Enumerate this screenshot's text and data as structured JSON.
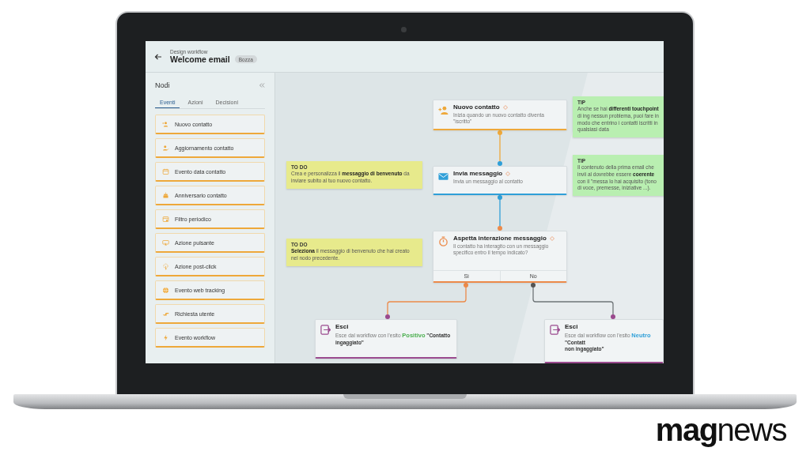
{
  "header": {
    "breadcrumb": "Design workflow",
    "title": "Welcome email",
    "badge": "Bozza"
  },
  "sidebar": {
    "title": "Nodi",
    "tabs": [
      {
        "label": "Eventi",
        "selected": true
      },
      {
        "label": "Azioni",
        "selected": false
      },
      {
        "label": "Decisioni",
        "selected": false
      }
    ],
    "items": [
      {
        "label": "Nuovo contatto"
      },
      {
        "label": "Aggiornamento contatto"
      },
      {
        "label": "Evento data contatto"
      },
      {
        "label": "Anniversario contatto"
      },
      {
        "label": "Filtro periodico"
      },
      {
        "label": "Azione pulsante"
      },
      {
        "label": "Azione post-click"
      },
      {
        "label": "Evento web tracking"
      },
      {
        "label": "Richiesta utente"
      },
      {
        "label": "Evento workflow"
      }
    ]
  },
  "canvas": {
    "nodes": [
      {
        "kind": "event",
        "title": "Nuovo contatto",
        "description": "Inizia quando un nuovo contatto diventa \"iscritto\""
      },
      {
        "kind": "action",
        "title": "Invia messaggio",
        "description": "Invia un messaggio al contatto"
      },
      {
        "kind": "decision",
        "title": "Aspetta interazione messaggio",
        "description": "Il contatto ha interagito con un messaggio specifico entro il tempo indicato?",
        "branches": [
          "Sì",
          "No"
        ]
      },
      {
        "kind": "exit",
        "title": "Esci",
        "description": "Esce dal workflow con l'esito",
        "outcome": {
          "text": "Positivo",
          "color": "#4caf50"
        },
        "outcome_label": "\"Contatto ingaggiato\""
      },
      {
        "kind": "exit",
        "title": "Esci",
        "description": "Esce dal workflow con l'esito",
        "outcome": {
          "text": "Neutro",
          "color": "#2f9fd8"
        },
        "outcome_label": "\"Contatt",
        "continuation": "non ingaggiato\""
      }
    ],
    "notes": [
      {
        "kind": "tip",
        "heading": "TIP",
        "text": "Anche se hai **differenti touchpoint** di ing nessun problema, puoi fare in modo che entrino i contatti iscritti in qualsiasi data"
      },
      {
        "kind": "todo",
        "heading": "TO DO",
        "text": "Crea e personalizza il **messaggio di benvenuto** da inviare subito al tuo nuovo contatto."
      },
      {
        "kind": "tip",
        "heading": "TIP",
        "text": "Il contenuto della prima email che invii al dovrebbe essere **coerente** con il \"messa lo hai acquisito (tono di voce, premesse, iniziative ...)."
      },
      {
        "kind": "todo",
        "heading": "TO DO",
        "text": "**Seleziona** il messaggio di benvenuto che hai creato nel nodo precedente."
      }
    ]
  },
  "brand": {
    "logo": "**mag**news"
  }
}
